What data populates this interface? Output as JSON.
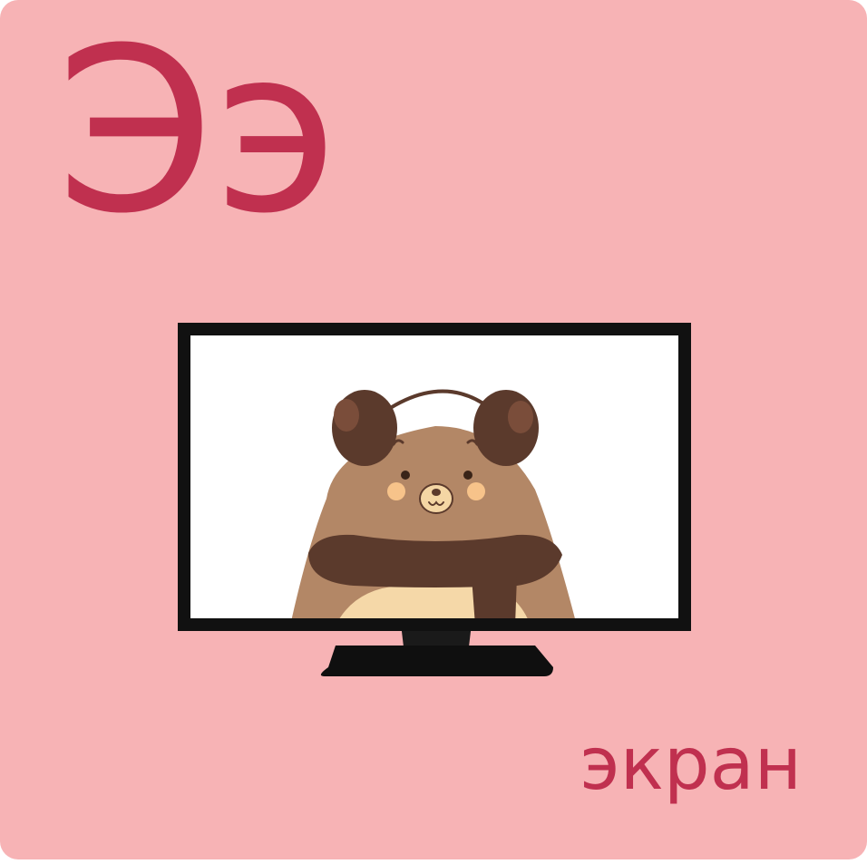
{
  "card": {
    "letters": "Ээ",
    "word": "экран"
  },
  "colors": {
    "background": "#f7b3b5",
    "text": "#c0304f",
    "bear_fur": "#b38766",
    "bear_dark": "#5b3a2c",
    "screen": "#ffffff",
    "tv_frame": "#111111"
  },
  "illustration": {
    "object": "tv-screen",
    "character": "bear-with-earmuffs-and-scarf"
  }
}
